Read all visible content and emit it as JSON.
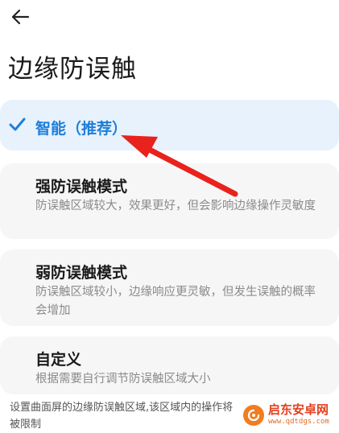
{
  "header": {
    "back_icon": "arrow-left-icon",
    "title": "边缘防误触"
  },
  "options": [
    {
      "title": "智能（推荐）",
      "description": "",
      "selected": true,
      "icon": "check-icon"
    },
    {
      "title": "强防误触模式",
      "description": "防误触区域较大，效果更好，但会影响边缘操作灵敏度",
      "selected": false
    },
    {
      "title": "弱防误触模式",
      "description": "防误触区域较小，边缘响应更灵敏，但发生误触的概率会增加",
      "selected": false
    },
    {
      "title": "自定义",
      "description": "根据需要自行调节防误触区域大小",
      "selected": false
    }
  ],
  "footer": {
    "text": "设置曲面屏的边缘防误触区域,该区域内的操作将被限制"
  },
  "annotation": {
    "icon": "red-arrow-icon",
    "color": "#e8231d"
  },
  "watermark": {
    "name": "启东安卓网",
    "url": "www.qdtdgs.com"
  },
  "colors": {
    "accent": "#1e7fd8",
    "selected_bg": "#e7f2fd",
    "card_bg": "#f6f6f6"
  }
}
